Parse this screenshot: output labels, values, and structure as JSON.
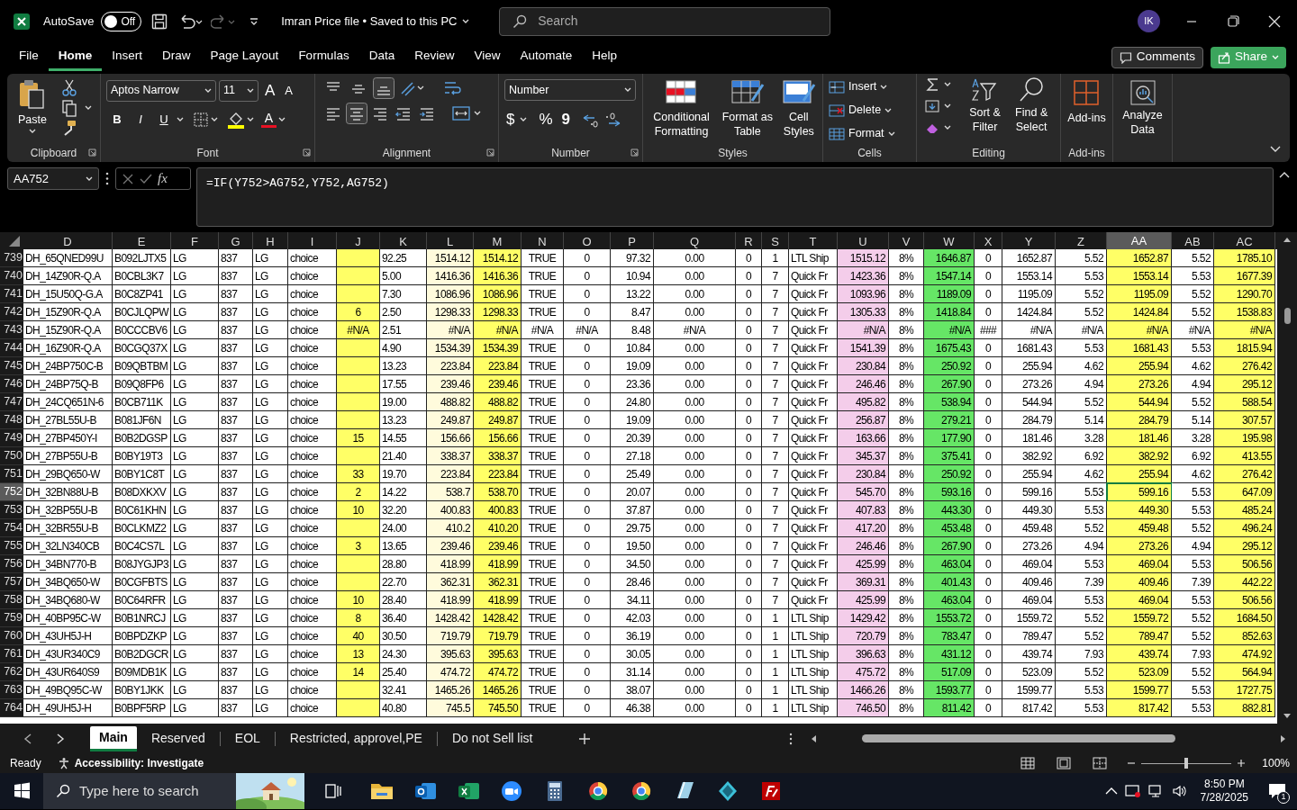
{
  "title_bar": {
    "autosave_label": "AutoSave",
    "autosave": {
      "on": false,
      "label": "Off"
    },
    "document_title": "Imran Price file • Saved to this PC",
    "search_placeholder": "Search",
    "avatar": "IK"
  },
  "menu_tabs": [
    {
      "label": "File",
      "selected": false
    },
    {
      "label": "Home",
      "selected": true
    },
    {
      "label": "Insert",
      "selected": false
    },
    {
      "label": "Draw",
      "selected": false
    },
    {
      "label": "Page Layout",
      "selected": false
    },
    {
      "label": "Formulas",
      "selected": false
    },
    {
      "label": "Data",
      "selected": false
    },
    {
      "label": "Review",
      "selected": false
    },
    {
      "label": "View",
      "selected": false
    },
    {
      "label": "Automate",
      "selected": false
    },
    {
      "label": "Help",
      "selected": false
    }
  ],
  "comments_button": "Comments",
  "share_button": "Share",
  "ribbon": {
    "clipboard": {
      "label": "Clipboard",
      "paste": "Paste"
    },
    "font": {
      "label": "Font",
      "font_name": "Aptos Narrow",
      "font_size": "11",
      "grow": "A",
      "shrink": "A",
      "styles": [
        "B",
        "I",
        "U"
      ],
      "font_color": "A"
    },
    "alignment": {
      "label": "Alignment"
    },
    "number": {
      "label": "Number",
      "format": "Number",
      "currency": "$",
      "percent": "%",
      "comma": "9"
    },
    "styles": {
      "label": "Styles",
      "buttons": [
        "Conditional Formatting",
        "Format as Table",
        "Cell Styles"
      ]
    },
    "cells": {
      "label": "Cells",
      "buttons": [
        "Insert",
        "Delete",
        "Format"
      ]
    },
    "editing": {
      "label": "Editing",
      "buttons": [
        "Sort & Filter",
        "Find & Select"
      ]
    },
    "addins": {
      "label": "Add-ins",
      "buttons": [
        "Add-ins"
      ]
    },
    "analyze": {
      "buttons": [
        "Analyze Data"
      ]
    }
  },
  "formula_bar": {
    "name_box": "AA752",
    "fx_label": "fx",
    "formula": "=IF(Y752>AG752,Y752,AG752)"
  },
  "columns": [
    {
      "label": "D",
      "selected": false
    },
    {
      "label": "E",
      "selected": false
    },
    {
      "label": "F",
      "selected": false
    },
    {
      "label": "G",
      "selected": false
    },
    {
      "label": "H",
      "selected": false
    },
    {
      "label": "I",
      "selected": false
    },
    {
      "label": "J",
      "selected": false,
      "color": "#ffff66"
    },
    {
      "label": "K",
      "selected": false
    },
    {
      "label": "L",
      "selected": false,
      "color": "#fffbdc"
    },
    {
      "label": "M",
      "selected": false,
      "color": "#ffff66"
    },
    {
      "label": "N",
      "selected": false
    },
    {
      "label": "O",
      "selected": false
    },
    {
      "label": "P",
      "selected": false
    },
    {
      "label": "Q",
      "selected": false
    },
    {
      "label": "R",
      "selected": false
    },
    {
      "label": "S",
      "selected": false
    },
    {
      "label": "T",
      "selected": false
    },
    {
      "label": "U",
      "selected": false,
      "color": "#f4cdea"
    },
    {
      "label": "V",
      "selected": false
    },
    {
      "label": "W",
      "selected": false,
      "color": "#66e666"
    },
    {
      "label": "X",
      "selected": false
    },
    {
      "label": "Y",
      "selected": false
    },
    {
      "label": "Z",
      "selected": false
    },
    {
      "label": "AA",
      "selected": true,
      "color": "#ffff66"
    },
    {
      "label": "AB",
      "selected": false
    },
    {
      "label": "AC",
      "selected": false,
      "color": "#ffff66"
    }
  ],
  "rows": [
    {
      "number": "739",
      "selected": false,
      "cells": [
        "DH_65QNED99U",
        "B092LJTX5",
        "LG",
        "837",
        "LG",
        "choice",
        null,
        "92.25",
        "1514.12",
        "1514.12",
        "TRUE",
        "0",
        "97.32",
        "0.00",
        "0",
        "1",
        "LTL Ship",
        "1515.12",
        "8%",
        "1646.87",
        "0",
        "1652.87",
        "5.52",
        "1652.87",
        "5.52",
        "1785.10"
      ]
    },
    {
      "number": "740",
      "selected": false,
      "cells": [
        "DH_14Z90R-Q.A",
        "B0CBL3K7",
        "LG",
        "837",
        "LG",
        "choice",
        null,
        "5.00",
        "1416.36",
        "1416.36",
        "TRUE",
        "0",
        "10.94",
        "0.00",
        "0",
        "7",
        "Quick Fr",
        "1423.36",
        "8%",
        "1547.14",
        "0",
        "1553.14",
        "5.53",
        "1553.14",
        "5.53",
        "1677.39"
      ]
    },
    {
      "number": "741",
      "selected": false,
      "cells": [
        "DH_15U50Q-G.A",
        "B0C8ZP41",
        "LG",
        "837",
        "LG",
        "choice",
        null,
        "7.30",
        "1086.96",
        "1086.96",
        "TRUE",
        "0",
        "13.22",
        "0.00",
        "0",
        "7",
        "Quick Fr",
        "1093.96",
        "8%",
        "1189.09",
        "0",
        "1195.09",
        "5.52",
        "1195.09",
        "5.52",
        "1290.70"
      ]
    },
    {
      "number": "742",
      "selected": false,
      "cells": [
        "DH_15Z90R-Q.A",
        "B0CJLQPW",
        "LG",
        "837",
        "LG",
        "choice",
        "6",
        "2.50",
        "1298.33",
        "1298.33",
        "TRUE",
        "0",
        "8.47",
        "0.00",
        "0",
        "7",
        "Quick Fr",
        "1305.33",
        "8%",
        "1418.84",
        "0",
        "1424.84",
        "5.52",
        "1424.84",
        "5.52",
        "1538.83"
      ]
    },
    {
      "number": "743",
      "selected": false,
      "cells": [
        "DH_15Z90R-Q.A",
        "B0CCCBV6",
        "LG",
        "837",
        "LG",
        "choice",
        "#N/A",
        "2.51",
        "#N/A",
        "#N/A",
        "#N/A",
        "#N/A",
        "8.48",
        "#N/A",
        "0",
        "7",
        "Quick Fr",
        "#N/A",
        "8%",
        "#N/A",
        "###",
        "#N/A",
        "#N/A",
        "#N/A",
        "#N/A",
        "#N/A"
      ]
    },
    {
      "number": "744",
      "selected": false,
      "cells": [
        "DH_16Z90R-Q.A",
        "B0CGQ37X",
        "LG",
        "837",
        "LG",
        "choice",
        null,
        "4.90",
        "1534.39",
        "1534.39",
        "TRUE",
        "0",
        "10.84",
        "0.00",
        "0",
        "7",
        "Quick Fr",
        "1541.39",
        "8%",
        "1675.43",
        "0",
        "1681.43",
        "5.53",
        "1681.43",
        "5.53",
        "1815.94"
      ]
    },
    {
      "number": "745",
      "selected": false,
      "cells": [
        "DH_24BP750C-B",
        "B09QBTBM",
        "LG",
        "837",
        "LG",
        "choice",
        null,
        "13.23",
        "223.84",
        "223.84",
        "TRUE",
        "0",
        "19.09",
        "0.00",
        "0",
        "7",
        "Quick Fr",
        "230.84",
        "8%",
        "250.92",
        "0",
        "255.94",
        "4.62",
        "255.94",
        "4.62",
        "276.42"
      ]
    },
    {
      "number": "746",
      "selected": false,
      "cells": [
        "DH_24BP75Q-B",
        "B09Q8FP6",
        "LG",
        "837",
        "LG",
        "choice",
        null,
        "17.55",
        "239.46",
        "239.46",
        "TRUE",
        "0",
        "23.36",
        "0.00",
        "0",
        "7",
        "Quick Fr",
        "246.46",
        "8%",
        "267.90",
        "0",
        "273.26",
        "4.94",
        "273.26",
        "4.94",
        "295.12"
      ]
    },
    {
      "number": "747",
      "selected": false,
      "cells": [
        "DH_24CQ651N-6",
        "B0CB711K",
        "LG",
        "837",
        "LG",
        "choice",
        null,
        "19.00",
        "488.82",
        "488.82",
        "TRUE",
        "0",
        "24.80",
        "0.00",
        "0",
        "7",
        "Quick Fr",
        "495.82",
        "8%",
        "538.94",
        "0",
        "544.94",
        "5.52",
        "544.94",
        "5.52",
        "588.54"
      ]
    },
    {
      "number": "748",
      "selected": false,
      "cells": [
        "DH_27BL55U-B",
        "B081JF6N",
        "LG",
        "837",
        "LG",
        "choice",
        null,
        "13.23",
        "249.87",
        "249.87",
        "TRUE",
        "0",
        "19.09",
        "0.00",
        "0",
        "7",
        "Quick Fr",
        "256.87",
        "8%",
        "279.21",
        "0",
        "284.79",
        "5.14",
        "284.79",
        "5.14",
        "307.57"
      ]
    },
    {
      "number": "749",
      "selected": false,
      "cells": [
        "DH_27BP450Y-I",
        "B0B2DGSP",
        "LG",
        "837",
        "LG",
        "choice",
        "15",
        "14.55",
        "156.66",
        "156.66",
        "TRUE",
        "0",
        "20.39",
        "0.00",
        "0",
        "7",
        "Quick Fr",
        "163.66",
        "8%",
        "177.90",
        "0",
        "181.46",
        "3.28",
        "181.46",
        "3.28",
        "195.98"
      ]
    },
    {
      "number": "750",
      "selected": false,
      "cells": [
        "DH_27BP55U-B",
        "B0BY19T3",
        "LG",
        "837",
        "LG",
        "choice",
        null,
        "21.40",
        "338.37",
        "338.37",
        "TRUE",
        "0",
        "27.18",
        "0.00",
        "0",
        "7",
        "Quick Fr",
        "345.37",
        "8%",
        "375.41",
        "0",
        "382.92",
        "6.92",
        "382.92",
        "6.92",
        "413.55"
      ]
    },
    {
      "number": "751",
      "selected": false,
      "cells": [
        "DH_29BQ650-W",
        "B0BY1C8T",
        "LG",
        "837",
        "LG",
        "choice",
        "33",
        "19.70",
        "223.84",
        "223.84",
        "TRUE",
        "0",
        "25.49",
        "0.00",
        "0",
        "7",
        "Quick Fr",
        "230.84",
        "8%",
        "250.92",
        "0",
        "255.94",
        "4.62",
        "255.94",
        "4.62",
        "276.42"
      ]
    },
    {
      "number": "752",
      "selected": true,
      "cells": [
        "DH_32BN88U-B",
        "B08DXKXV",
        "LG",
        "837",
        "LG",
        "choice",
        "2",
        "14.22",
        "538.7",
        "538.70",
        "TRUE",
        "0",
        "20.07",
        "0.00",
        "0",
        "7",
        "Quick Fr",
        "545.70",
        "8%",
        "593.16",
        "0",
        "599.16",
        "5.53",
        "599.16",
        "5.53",
        "647.09"
      ]
    },
    {
      "number": "753",
      "selected": false,
      "cells": [
        "DH_32BP55U-B",
        "B0C61KHN",
        "LG",
        "837",
        "LG",
        "choice",
        "10",
        "32.20",
        "400.83",
        "400.83",
        "TRUE",
        "0",
        "37.87",
        "0.00",
        "0",
        "7",
        "Quick Fr",
        "407.83",
        "8%",
        "443.30",
        "0",
        "449.30",
        "5.53",
        "449.30",
        "5.53",
        "485.24"
      ]
    },
    {
      "number": "754",
      "selected": false,
      "cells": [
        "DH_32BR55U-B",
        "B0CLKMZ2",
        "LG",
        "837",
        "LG",
        "choice",
        null,
        "24.00",
        "410.2",
        "410.20",
        "TRUE",
        "0",
        "29.75",
        "0.00",
        "0",
        "7",
        "Quick Fr",
        "417.20",
        "8%",
        "453.48",
        "0",
        "459.48",
        "5.52",
        "459.48",
        "5.52",
        "496.24"
      ]
    },
    {
      "number": "755",
      "selected": false,
      "cells": [
        "DH_32LN340CB",
        "B0C4CS7L",
        "LG",
        "837",
        "LG",
        "choice",
        "3",
        "13.65",
        "239.46",
        "239.46",
        "TRUE",
        "0",
        "19.50",
        "0.00",
        "0",
        "7",
        "Quick Fr",
        "246.46",
        "8%",
        "267.90",
        "0",
        "273.26",
        "4.94",
        "273.26",
        "4.94",
        "295.12"
      ]
    },
    {
      "number": "756",
      "selected": false,
      "cells": [
        "DH_34BN770-B",
        "B08JYGJP3",
        "LG",
        "837",
        "LG",
        "choice",
        null,
        "28.80",
        "418.99",
        "418.99",
        "TRUE",
        "0",
        "34.50",
        "0.00",
        "0",
        "7",
        "Quick Fr",
        "425.99",
        "8%",
        "463.04",
        "0",
        "469.04",
        "5.53",
        "469.04",
        "5.53",
        "506.56"
      ]
    },
    {
      "number": "757",
      "selected": false,
      "cells": [
        "DH_34BQ650-W",
        "B0CGFBTS",
        "LG",
        "837",
        "LG",
        "choice",
        null,
        "22.70",
        "362.31",
        "362.31",
        "TRUE",
        "0",
        "28.46",
        "0.00",
        "0",
        "7",
        "Quick Fr",
        "369.31",
        "8%",
        "401.43",
        "0",
        "409.46",
        "7.39",
        "409.46",
        "7.39",
        "442.22"
      ]
    },
    {
      "number": "758",
      "selected": false,
      "cells": [
        "DH_34BQ680-W",
        "B0C64RFR",
        "LG",
        "837",
        "LG",
        "choice",
        "10",
        "28.40",
        "418.99",
        "418.99",
        "TRUE",
        "0",
        "34.11",
        "0.00",
        "0",
        "7",
        "Quick Fr",
        "425.99",
        "8%",
        "463.04",
        "0",
        "469.04",
        "5.53",
        "469.04",
        "5.53",
        "506.56"
      ]
    },
    {
      "number": "759",
      "selected": false,
      "cells": [
        "DH_40BP95C-W",
        "B0B1NRCJ",
        "LG",
        "837",
        "LG",
        "choice",
        "8",
        "36.40",
        "1428.42",
        "1428.42",
        "TRUE",
        "0",
        "42.03",
        "0.00",
        "0",
        "1",
        "LTL Ship",
        "1429.42",
        "8%",
        "1553.72",
        "0",
        "1559.72",
        "5.52",
        "1559.72",
        "5.52",
        "1684.50"
      ]
    },
    {
      "number": "760",
      "selected": false,
      "cells": [
        "DH_43UH5J-H",
        "B0BPDZKP",
        "LG",
        "837",
        "LG",
        "choice",
        "40",
        "30.50",
        "719.79",
        "719.79",
        "TRUE",
        "0",
        "36.19",
        "0.00",
        "0",
        "1",
        "LTL Ship",
        "720.79",
        "8%",
        "783.47",
        "0",
        "789.47",
        "5.52",
        "789.47",
        "5.52",
        "852.63"
      ]
    },
    {
      "number": "761",
      "selected": false,
      "cells": [
        "DH_43UR340C9",
        "B0B2DGCR",
        "LG",
        "837",
        "LG",
        "choice",
        "13",
        "24.30",
        "395.63",
        "395.63",
        "TRUE",
        "0",
        "30.05",
        "0.00",
        "0",
        "1",
        "LTL Ship",
        "396.63",
        "8%",
        "431.12",
        "0",
        "439.74",
        "7.93",
        "439.74",
        "7.93",
        "474.92"
      ]
    },
    {
      "number": "762",
      "selected": false,
      "cells": [
        "DH_43UR640S9",
        "B09MDB1K",
        "LG",
        "837",
        "LG",
        "choice",
        "14",
        "25.40",
        "474.72",
        "474.72",
        "TRUE",
        "0",
        "31.14",
        "0.00",
        "0",
        "1",
        "LTL Ship",
        "475.72",
        "8%",
        "517.09",
        "0",
        "523.09",
        "5.52",
        "523.09",
        "5.52",
        "564.94"
      ]
    },
    {
      "number": "763",
      "selected": false,
      "cells": [
        "DH_49BQ95C-W",
        "B0BY1JKK",
        "LG",
        "837",
        "LG",
        "choice",
        null,
        "32.41",
        "1465.26",
        "1465.26",
        "TRUE",
        "0",
        "38.07",
        "0.00",
        "0",
        "1",
        "LTL Ship",
        "1466.26",
        "8%",
        "1593.77",
        "0",
        "1599.77",
        "5.53",
        "1599.77",
        "5.53",
        "1727.75"
      ]
    },
    {
      "number": "764",
      "selected": false,
      "cells": [
        "DH_49UH5J-H",
        "B0BPF5RP",
        "LG",
        "837",
        "LG",
        "choice",
        null,
        "40.80",
        "745.5",
        "745.50",
        "TRUE",
        "0",
        "46.38",
        "0.00",
        "0",
        "1",
        "LTL Ship",
        "746.50",
        "8%",
        "811.42",
        "0",
        "817.42",
        "5.53",
        "817.42",
        "5.53",
        "882.81"
      ]
    }
  ],
  "sheet_tabs": [
    {
      "label": "Main",
      "selected": true
    },
    {
      "label": "Reserved",
      "selected": false
    },
    {
      "label": "EOL",
      "selected": false
    },
    {
      "label": "Restricted, approvel,PE",
      "selected": false
    },
    {
      "label": "Do not Sell list",
      "selected": false
    }
  ],
  "status_bar": {
    "status": "Ready",
    "accessibility": "Accessibility: Investigate",
    "zoom": {
      "level": 0.5,
      "label": "100%"
    }
  },
  "taskbar": {
    "search_placeholder": "Type here to search",
    "time": "8:50 PM",
    "date": "7/28/2025",
    "notifications": "1"
  }
}
